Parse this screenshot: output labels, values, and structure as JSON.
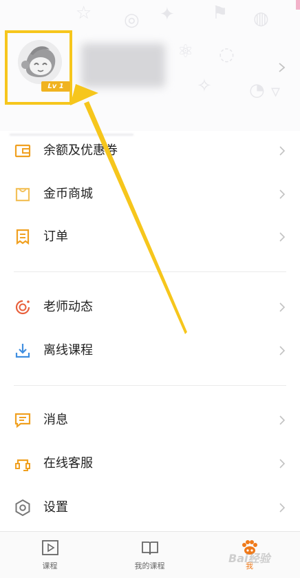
{
  "profile": {
    "level_badge": "Lv 1"
  },
  "menu": {
    "balance": "余额及优惠券",
    "coin_mall": "金币商城",
    "orders": "订单",
    "teacher_updates": "老师动态",
    "offline_courses": "离线课程",
    "messages": "消息",
    "customer_service": "在线客服",
    "settings": "设置"
  },
  "tabbar": {
    "courses": "课程",
    "my_courses": "我的课程",
    "me": "我"
  },
  "watermark": "Bai经验",
  "colors": {
    "accent_orange": "#ef7a1b",
    "icon_orange": "#f0a020",
    "highlight_yellow": "#f6c61c",
    "teacher_red": "#e8603c",
    "offline_blue": "#3f8ee0",
    "settings_gray": "#777777"
  },
  "icons": {
    "balance": "wallet-icon",
    "coin_mall": "shopping-bag-icon",
    "orders": "receipt-icon",
    "teacher_updates": "teacher-dynamic-icon",
    "offline_courses": "download-icon",
    "messages": "message-icon",
    "customer_service": "headset-icon",
    "settings": "gear-icon"
  }
}
